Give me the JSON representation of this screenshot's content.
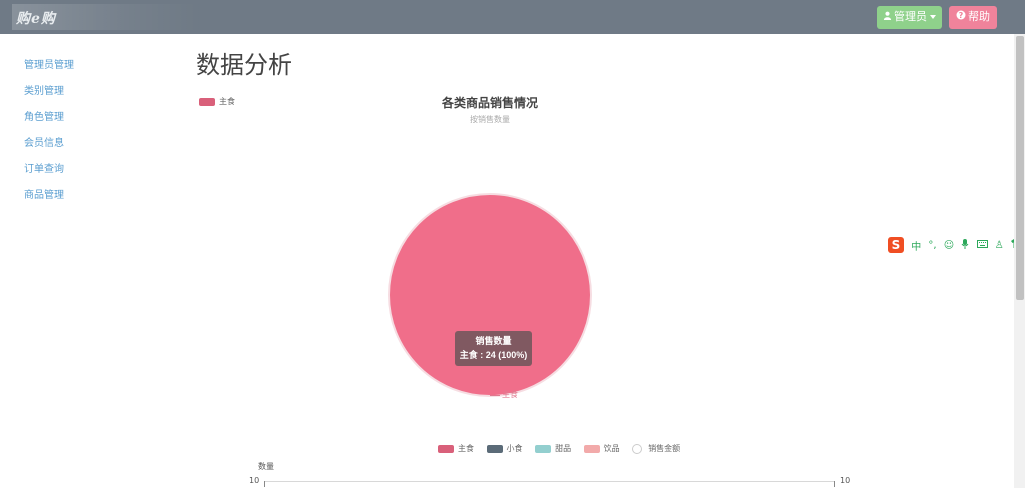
{
  "navbar": {
    "brand": "购e购",
    "admin_label": "管理员",
    "help_label": "帮助",
    "admin_color": "#8fd18b",
    "help_color": "#f0839b"
  },
  "sidebar": {
    "items": [
      {
        "label": "管理员管理"
      },
      {
        "label": "类别管理"
      },
      {
        "label": "角色管理"
      },
      {
        "label": "会员信息"
      },
      {
        "label": "订单查询"
      },
      {
        "label": "商品管理"
      }
    ]
  },
  "page": {
    "title": "数据分析"
  },
  "chart_data": [
    {
      "type": "pie",
      "title": "各类商品销售情况",
      "subtitle": "按销售数量",
      "legend": [
        "主食"
      ],
      "legend_placement": "top-left",
      "series": [
        {
          "name": "销售数量",
          "slices": [
            {
              "label": "主食",
              "value": 24,
              "percent": 100
            }
          ]
        }
      ],
      "tooltip": {
        "title": "销售数量",
        "text": "主食 : 24 (100%)"
      },
      "slice_label": "主食",
      "color": "#f06e8a"
    },
    {
      "type": "bar",
      "legend": [
        "主食",
        "小食",
        "甜品",
        "饮品",
        "销售金额"
      ],
      "legend_colors": [
        "#d9607a",
        "#5b6b78",
        "#93cfcf",
        "#f2aaaa",
        "#ffffff"
      ],
      "legend_placement": "top",
      "ylabel": "数量",
      "y_tick_left": "10",
      "y_tick_right": "10"
    }
  ],
  "ime": {
    "logo": "S",
    "mode": "中"
  }
}
